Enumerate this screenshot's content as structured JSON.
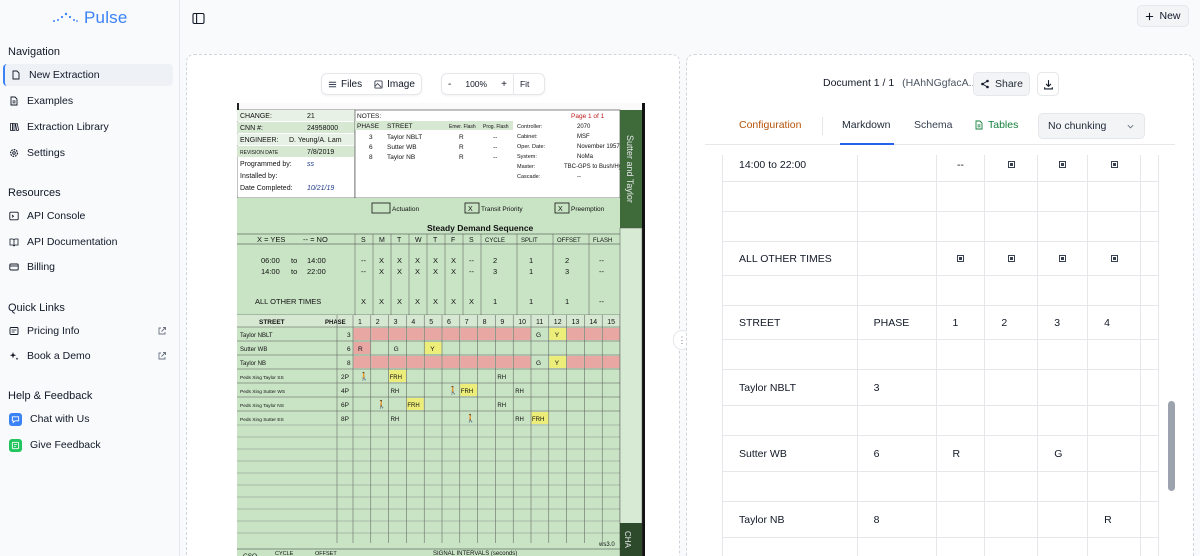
{
  "brand": {
    "name": "Pulse",
    "color": "#3b82f6"
  },
  "sidebar": {
    "navigation_title": "Navigation",
    "navigation": [
      {
        "label": "New Extraction",
        "icon": "file-icon",
        "active": true
      },
      {
        "label": "Examples",
        "icon": "file-text-icon"
      },
      {
        "label": "Extraction Library",
        "icon": "book-icon"
      },
      {
        "label": "Settings",
        "icon": "gear-icon"
      }
    ],
    "resources_title": "Resources",
    "resources": [
      {
        "label": "API Console",
        "icon": "terminal-icon"
      },
      {
        "label": "API Documentation",
        "icon": "book-open-icon"
      },
      {
        "label": "Billing",
        "icon": "credit-card-icon"
      }
    ],
    "quick_links_title": "Quick Links",
    "quick_links": [
      {
        "label": "Pricing Info",
        "icon": "file-icon"
      },
      {
        "label": "Book a Demo",
        "icon": "sparkle-icon"
      }
    ],
    "help_title": "Help & Feedback",
    "help": [
      {
        "label": "Chat with Us",
        "icon": "chat-icon",
        "color": "#3b82f6"
      },
      {
        "label": "Give Feedback",
        "icon": "feedback-icon",
        "color": "#22c55e"
      }
    ]
  },
  "header": {
    "new_label": "New"
  },
  "preview": {
    "files_label": "Files",
    "image_label": "Image",
    "zoom_out": "-",
    "zoom": "100%",
    "zoom_in": "+",
    "fit": "Fit",
    "scan": {
      "header": [
        {
          "label": "CHANGE:",
          "value": "21"
        },
        {
          "label": "CNN #:",
          "value": "24958000"
        },
        {
          "label": "ENGINEER:",
          "value": "D. Yeung/A. Lam"
        },
        {
          "label": "REVISION DATE",
          "value": "7/8/2019"
        },
        {
          "label": "Programmed by:",
          "value": "ss"
        },
        {
          "label": "Installed by:",
          "value": ""
        },
        {
          "label": "Date Completed:",
          "value": "10/21/19"
        }
      ],
      "notes": {
        "label": "NOTES:",
        "page": "Page 1 of 1"
      },
      "phase_table_headers": [
        "PHASE",
        "STREET",
        "Emer. Flash",
        "Prog. Flash"
      ],
      "phase_rows": [
        [
          "3",
          "Taylor NBLT",
          "R",
          "--"
        ],
        [
          "6",
          "Sutter WB",
          "R",
          "--"
        ],
        [
          "8",
          "Taylor NB",
          "R",
          "--"
        ]
      ],
      "controller": [
        {
          "label": "Controller:",
          "value": "2070"
        },
        {
          "label": "Cabinet:",
          "value": "MSF"
        },
        {
          "label": "Oper. Date:",
          "value": "November 1957"
        },
        {
          "label": "System:",
          "value": "NoMa"
        },
        {
          "label": "Master:",
          "value": "TBC-GPS to Bush/Hyde"
        },
        {
          "label": "Cascade:",
          "value": "--"
        }
      ],
      "side_title": "Sutter and Taylor",
      "actuation": {
        "actuation": "Actuation",
        "transit": "Transit Priority",
        "preemption": "Preemption",
        "transit_mark": "X",
        "preemption_mark": "X"
      },
      "sequence_title": "Steady Demand Sequence",
      "legend_yes": "X = YES",
      "legend_no": "-- = NO",
      "days": [
        "S",
        "M",
        "T",
        "W",
        "T",
        "F",
        "S"
      ],
      "seq_cols": [
        "CYCLE",
        "SPLIT",
        "OFFSET",
        "FLASH"
      ],
      "sequences": [
        {
          "label_a": "06:00",
          "to": "to",
          "label_b": "14:00",
          "days": [
            "--",
            "X",
            "X",
            "X",
            "X",
            "X",
            "--"
          ],
          "cycle": "2",
          "split": "1",
          "offset": "2",
          "flash": "--"
        },
        {
          "label_a": "14:00",
          "to": "to",
          "label_b": "22:00",
          "days": [
            "--",
            "X",
            "X",
            "X",
            "X",
            "X",
            "--"
          ],
          "cycle": "3",
          "split": "1",
          "offset": "3",
          "flash": "--"
        },
        {
          "label_a": "ALL OTHER TIMES",
          "to": "",
          "label_b": "",
          "days": [
            "X",
            "X",
            "X",
            "X",
            "X",
            "X",
            "X"
          ],
          "cycle": "1",
          "split": "1",
          "offset": "1",
          "flash": "--"
        }
      ],
      "interval_header_street": "STREET",
      "interval_header_phase": "PHASE",
      "intervals": [
        "1",
        "2",
        "3",
        "4",
        "5",
        "6",
        "7",
        "8",
        "9",
        "10",
        "11",
        "12",
        "13",
        "14",
        "15"
      ],
      "interval_rows": [
        {
          "street": "Taylor NBLT",
          "phase": "3"
        },
        {
          "street": "Sutter WB",
          "phase": "6"
        },
        {
          "street": "Taylor NB",
          "phase": "8"
        },
        {
          "street": "Peds Xing Taylor SS",
          "phase": "2P"
        },
        {
          "street": "Peds Xing Sutter WS",
          "phase": "4P"
        },
        {
          "street": "Peds Xing Taylor NS",
          "phase": "6P"
        },
        {
          "street": "Peds Xing Sutter ES",
          "phase": "8P"
        }
      ],
      "cell_codes": {
        "r": "R",
        "g": "G",
        "y": "Y",
        "rh": "RH",
        "frh": "FRH",
        "walk": "WALK"
      },
      "footer_cols": [
        "CSO",
        "CYCLE",
        "OFFSET"
      ],
      "footer_title": "SIGNAL INTERVALS (seconds)",
      "footer_version": "ws3.0",
      "side_footer": "CHA"
    }
  },
  "document": {
    "label": "Document 1 / 1",
    "id": "(HAhNGgfacA...)",
    "share_label": "Share",
    "tabs": [
      {
        "label": "Configuration"
      },
      {
        "label": "Markdown",
        "active": true
      },
      {
        "label": "Schema"
      },
      {
        "label": "Tables"
      }
    ],
    "chunking": "No chunking",
    "table": {
      "rows": [
        {
          "type": "time",
          "c1": "14:00 to 22:00",
          "c2": "",
          "c3": "--",
          "marks": [
            true,
            true,
            true
          ]
        },
        {
          "type": "blank"
        },
        {
          "type": "blank"
        },
        {
          "type": "time",
          "c1": "ALL OTHER TIMES",
          "c2": "",
          "c3": "",
          "marks": [
            true,
            true,
            true,
            true
          ]
        },
        {
          "type": "blank"
        },
        {
          "type": "header",
          "c1": "STREET",
          "c2": "PHASE",
          "cols": [
            "1",
            "2",
            "3",
            "4"
          ]
        },
        {
          "type": "blank"
        },
        {
          "type": "data",
          "c1": "Taylor NBLT",
          "c2": "3",
          "cols": [
            "",
            "",
            "",
            ""
          ]
        },
        {
          "type": "blank"
        },
        {
          "type": "data",
          "c1": "Sutter WB",
          "c2": "6",
          "cols": [
            "R",
            "",
            "G",
            ""
          ]
        },
        {
          "type": "blank"
        },
        {
          "type": "data",
          "c1": "Taylor NB",
          "c2": "8",
          "cols": [
            "",
            "",
            "",
            "R"
          ]
        },
        {
          "type": "blank"
        }
      ]
    }
  },
  "colors": {
    "scan_green": "#c9e4c5",
    "scan_red": "#e8a7a2",
    "scan_yellow": "#eded7a",
    "accent": "#2563eb",
    "config_tab": "#b45309",
    "tables_tab": "#15803d"
  }
}
